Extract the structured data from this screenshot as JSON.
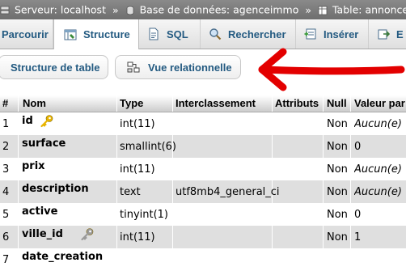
{
  "breadcrumb": {
    "server": "Serveur: localhost",
    "db": "Base de données: agenceimmo",
    "table": "Table: annonce",
    "sep": "»"
  },
  "tabs": [
    {
      "label": "Parcourir",
      "icon": "browse-icon"
    },
    {
      "label": "Structure",
      "icon": "structure-icon"
    },
    {
      "label": "SQL",
      "icon": "sql-icon"
    },
    {
      "label": "Rechercher",
      "icon": "search-icon"
    },
    {
      "label": "Insérer",
      "icon": "insert-icon"
    },
    {
      "label": "E",
      "icon": "export-icon"
    }
  ],
  "subtabs": {
    "table_structure": "Structure de table",
    "relational_view": "Vue relationnelle"
  },
  "table": {
    "headers": [
      "#",
      "Nom",
      "Type",
      "Interclassement",
      "Attributs",
      "Null",
      "Valeur par"
    ],
    "rows": [
      {
        "num": "1",
        "name": "id",
        "type": "int(11)",
        "collation": "",
        "null": "Non",
        "default": "Aucun(e)",
        "default_italic": true,
        "key": "primary"
      },
      {
        "num": "2",
        "name": "surface",
        "type": "smallint(6)",
        "collation": "",
        "null": "Non",
        "default": "0",
        "default_italic": false,
        "key": ""
      },
      {
        "num": "3",
        "name": "prix",
        "type": "int(11)",
        "collation": "",
        "null": "Non",
        "default": "Aucun(e)",
        "default_italic": true,
        "key": ""
      },
      {
        "num": "4",
        "name": "description",
        "type": "text",
        "collation": "utf8mb4_general_ci",
        "null": "Non",
        "default": "Aucun(e)",
        "default_italic": true,
        "key": ""
      },
      {
        "num": "5",
        "name": "active",
        "type": "tinyint(1)",
        "collation": "",
        "null": "Non",
        "default": "0",
        "default_italic": false,
        "key": ""
      },
      {
        "num": "6",
        "name": "ville_id",
        "type": "int(11)",
        "collation": "",
        "null": "Non",
        "default": "1",
        "default_italic": false,
        "key": "index"
      },
      {
        "num": "7",
        "name": "date_creation",
        "type": "",
        "collation": "",
        "null": "",
        "default": "",
        "default_italic": false,
        "key": ""
      }
    ]
  },
  "colors": {
    "accent": "#235a81",
    "arrow": "#e30000",
    "key_gold": "#e8b400",
    "key_grey": "#9a9a9a"
  }
}
